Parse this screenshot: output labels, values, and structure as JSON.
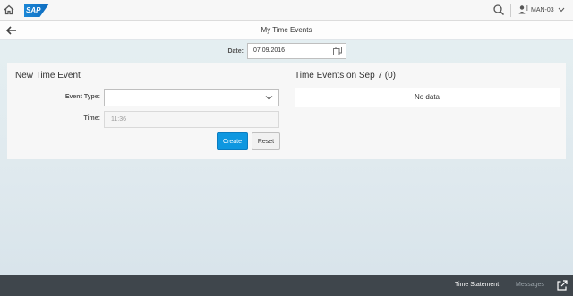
{
  "shell": {
    "logo": "SAP",
    "user": "MAN-03"
  },
  "header": {
    "title": "My Time Events"
  },
  "date": {
    "label": "Date:",
    "value": "07.09.2016"
  },
  "new_event": {
    "title": "New Time Event",
    "event_type_label": "Event Type:",
    "event_type_value": "",
    "time_label": "Time:",
    "time_value": "11:36",
    "create_label": "Create",
    "reset_label": "Reset"
  },
  "events_list": {
    "title": "Time Events on Sep 7 (0)",
    "empty_text": "No data"
  },
  "footer": {
    "time_statement": "Time Statement",
    "messages": "Messages"
  },
  "colors": {
    "accent": "#0e97e0",
    "footer_bg": "#3f464c"
  }
}
